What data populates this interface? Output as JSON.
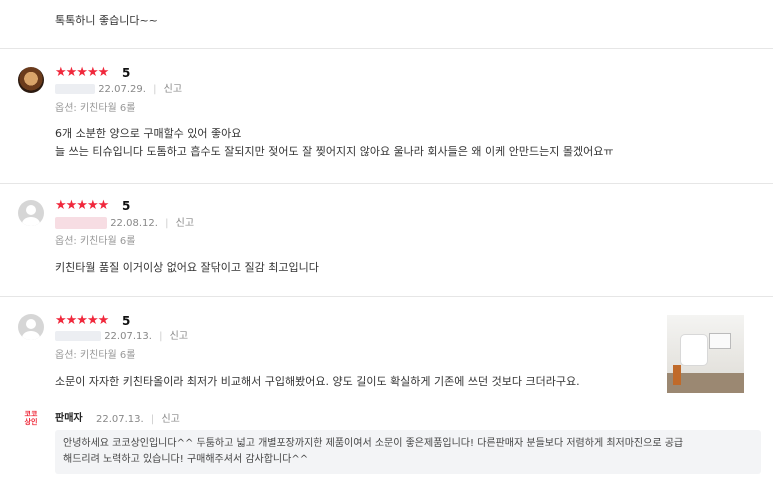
{
  "top_review_text": "톡톡하니 좋습니다~~",
  "common": {
    "stars": "★★★★★",
    "report_label": "신고",
    "separator": "|"
  },
  "reviews": [
    {
      "score": "5",
      "date": "22.07.29.",
      "option": "옵션: 키친타월 6롤",
      "lines": [
        "6개 소분한 양으로 구매할수 있어 좋아요",
        "늘 쓰는 티슈입니다 도톰하고 흡수도 잘되지만 젖어도 잘 찢어지지 않아요 울나라 회사들은 왜 이케 안만드는지 몰겠어요ㅠ"
      ]
    },
    {
      "score": "5",
      "date": "22.08.12.",
      "option": "옵션: 키친타월 6롤",
      "lines": [
        "키친타월 품질 이거이상 없어요 잘닦이고 질감 최고입니다"
      ]
    },
    {
      "score": "5",
      "date": "22.07.13.",
      "option": "옵션: 키친타월 6롤",
      "lines": [
        "소문이 자자한 키친타올이라 최저가 비교해서 구입해봤어요. 양도 길이도 확실하게 기존에 쓰던 것보다 크더라구요."
      ],
      "seller_reply": {
        "logo_text": "코코 상인",
        "name": "판매자",
        "date": "22.07.13.",
        "lines": [
          "안녕하세요 코코상인입니다^^ 두툼하고 넓고 개별포장까지한 제품이여서 소문이 좋은제품입니다! 다른판매자 분들보다 저렴하게 최저마진으로 공급",
          "해드리려 노력하고 있습니다! 구매해주셔서 감사합니다^^"
        ]
      }
    }
  ],
  "colors": {
    "star": "#f0283c",
    "divider": "#e6e6e6",
    "reply_bg": "#f3f4f6"
  }
}
